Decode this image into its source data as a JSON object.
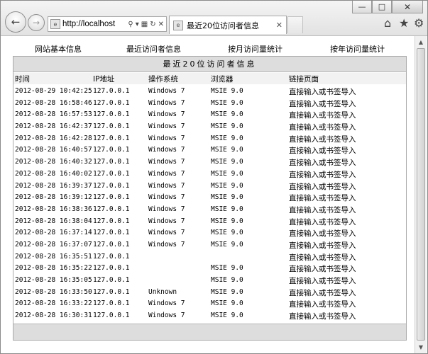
{
  "browser": {
    "address_url": "http://localhost",
    "address_favicon": "ie",
    "tab_title": "最近20位访问者信息",
    "tab_favicon": "ie",
    "icons": [
      "back-arrow-icon",
      "forward-arrow-icon",
      "search-icon",
      "dropdown-icon",
      "compatibility-icon",
      "refresh-icon",
      "stop-icon",
      "home-icon",
      "star-icon",
      "gear-icon",
      "minimize-icon",
      "maximize-icon",
      "close-icon"
    ]
  },
  "nav": {
    "site_info": "网站基本信息",
    "recent_visitors": "最近访问者信息",
    "monthly_stats": "按月访问量统计",
    "yearly_stats": "按年访问量统计"
  },
  "panel": {
    "title": "最近20位访问者信息",
    "columns": [
      "时间",
      "IP地址",
      "操作系统",
      "浏览器",
      "链接页面"
    ]
  },
  "rows": [
    {
      "time": "2012-08-29 10:42:25",
      "ip": "127.0.0.1",
      "os": "Windows 7",
      "browser": "MSIE 9.0",
      "link": "直接输入或书签导入"
    },
    {
      "time": "2012-08-28 16:58:46",
      "ip": "127.0.0.1",
      "os": "Windows 7",
      "browser": "MSIE 9.0",
      "link": "直接输入或书签导入"
    },
    {
      "time": "2012-08-28 16:57:53",
      "ip": "127.0.0.1",
      "os": "Windows 7",
      "browser": "MSIE 9.0",
      "link": "直接输入或书签导入"
    },
    {
      "time": "2012-08-28 16:42:37",
      "ip": "127.0.0.1",
      "os": "Windows 7",
      "browser": "MSIE 9.0",
      "link": "直接输入或书签导入"
    },
    {
      "time": "2012-08-28 16:42:28",
      "ip": "127.0.0.1",
      "os": "Windows 7",
      "browser": "MSIE 9.0",
      "link": "直接输入或书签导入"
    },
    {
      "time": "2012-08-28 16:40:57",
      "ip": "127.0.0.1",
      "os": "Windows 7",
      "browser": "MSIE 9.0",
      "link": "直接输入或书签导入"
    },
    {
      "time": "2012-08-28 16:40:32",
      "ip": "127.0.0.1",
      "os": "Windows 7",
      "browser": "MSIE 9.0",
      "link": "直接输入或书签导入"
    },
    {
      "time": "2012-08-28 16:40:02",
      "ip": "127.0.0.1",
      "os": "Windows 7",
      "browser": "MSIE 9.0",
      "link": "直接输入或书签导入"
    },
    {
      "time": "2012-08-28 16:39:37",
      "ip": "127.0.0.1",
      "os": "Windows 7",
      "browser": "MSIE 9.0",
      "link": "直接输入或书签导入"
    },
    {
      "time": "2012-08-28 16:39:12",
      "ip": "127.0.0.1",
      "os": "Windows 7",
      "browser": "MSIE 9.0",
      "link": "直接输入或书签导入"
    },
    {
      "time": "2012-08-28 16:38:36",
      "ip": "127.0.0.1",
      "os": "Windows 7",
      "browser": "MSIE 9.0",
      "link": "直接输入或书签导入"
    },
    {
      "time": "2012-08-28 16:38:04",
      "ip": "127.0.0.1",
      "os": "Windows 7",
      "browser": "MSIE 9.0",
      "link": "直接输入或书签导入"
    },
    {
      "time": "2012-08-28 16:37:14",
      "ip": "127.0.0.1",
      "os": "Windows 7",
      "browser": "MSIE 9.0",
      "link": "直接输入或书签导入"
    },
    {
      "time": "2012-08-28 16:37:07",
      "ip": "127.0.0.1",
      "os": "Windows 7",
      "browser": "MSIE 9.0",
      "link": "直接输入或书签导入"
    },
    {
      "time": "2012-08-28 16:35:51",
      "ip": "127.0.0.1",
      "os": "",
      "browser": "",
      "link": "直接输入或书签导入"
    },
    {
      "time": "2012-08-28 16:35:22",
      "ip": "127.0.0.1",
      "os": "",
      "browser": "MSIE 9.0",
      "link": "直接输入或书签导入"
    },
    {
      "time": "2012-08-28 16:35:05",
      "ip": "127.0.0.1",
      "os": "",
      "browser": "MSIE 9.0",
      "link": "直接输入或书签导入"
    },
    {
      "time": "2012-08-28 16:33:50",
      "ip": "127.0.0.1",
      "os": "Unknown",
      "browser": "MSIE 9.0",
      "link": "直接输入或书签导入"
    },
    {
      "time": "2012-08-28 16:33:22",
      "ip": "127.0.0.1",
      "os": "Windows 7",
      "browser": "MSIE 9.0",
      "link": "直接输入或书签导入"
    },
    {
      "time": "2012-08-28 16:30:31",
      "ip": "127.0.0.1",
      "os": "Windows 7",
      "browser": "MSIE 9.0",
      "link": "直接输入或书签导入"
    }
  ]
}
